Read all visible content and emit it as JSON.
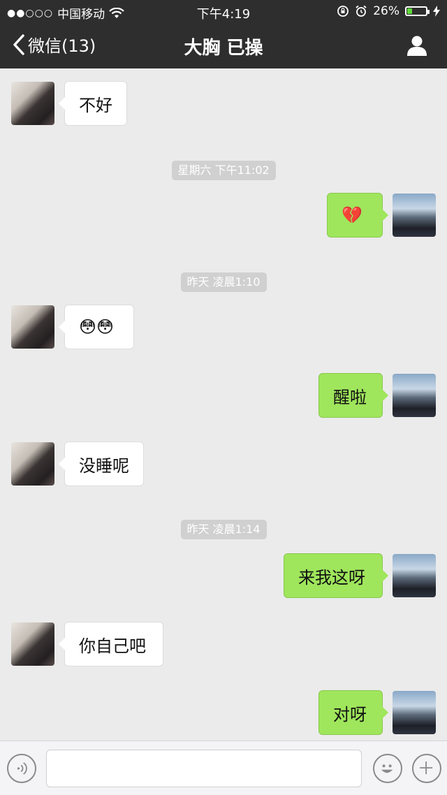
{
  "status": {
    "signal_dots": "●●○○○",
    "carrier": "中国移动",
    "time": "下午4:19",
    "battery": "26%",
    "battery_level": 0.26
  },
  "nav": {
    "back_label": "微信(13)",
    "title": "大胸 已操"
  },
  "messages": [
    {
      "type": "in",
      "text": "不好"
    },
    {
      "type": "time",
      "text": "星期六 下午11:02"
    },
    {
      "type": "out",
      "text": "💔"
    },
    {
      "type": "time",
      "text": "昨天 凌晨1:10"
    },
    {
      "type": "in",
      "text": "😳😳"
    },
    {
      "type": "out",
      "text": "醒啦"
    },
    {
      "type": "in",
      "text": "没睡呢"
    },
    {
      "type": "time",
      "text": "昨天 凌晨1:14"
    },
    {
      "type": "out",
      "text": "来我这呀"
    },
    {
      "type": "in",
      "text": "你自己吧"
    },
    {
      "type": "out",
      "text": "对呀"
    }
  ],
  "colors": {
    "bar": "#2e2e2e",
    "outgoing_bubble": "#9fe65c",
    "background": "#ebebeb"
  }
}
